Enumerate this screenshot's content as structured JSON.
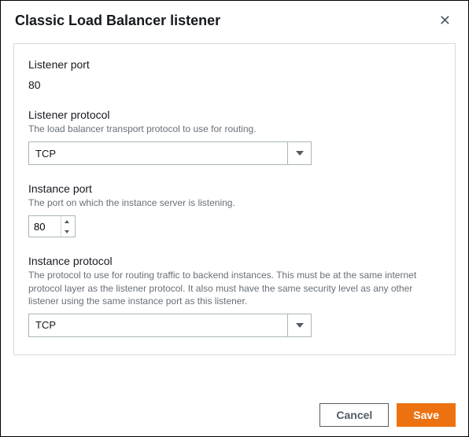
{
  "dialog": {
    "title": "Classic Load Balancer listener"
  },
  "listener_port": {
    "label": "Listener port",
    "value": "80"
  },
  "listener_protocol": {
    "label": "Listener protocol",
    "description": "The load balancer transport protocol to use for routing.",
    "value": "TCP"
  },
  "instance_port": {
    "label": "Instance port",
    "description": "The port on which the instance server is listening.",
    "value": "80"
  },
  "instance_protocol": {
    "label": "Instance protocol",
    "description": "The protocol to use for routing traffic to backend instances. This must be at the same internet protocol layer as the listener protocol. It also must have the same security level as any other listener using the same instance port as this listener.",
    "value": "TCP"
  },
  "buttons": {
    "cancel": "Cancel",
    "save": "Save"
  }
}
